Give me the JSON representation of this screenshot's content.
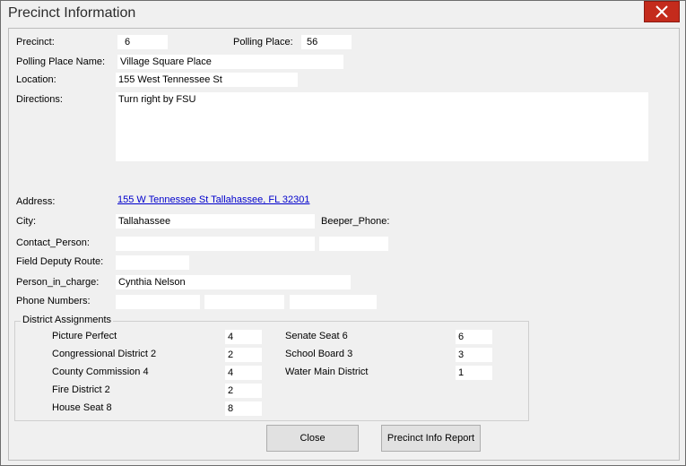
{
  "window": {
    "title": "Precinct Information"
  },
  "fields": {
    "precinct_label": "Precinct:",
    "precinct_value": "6",
    "polling_place_label": "Polling Place:",
    "polling_place_value": "56",
    "polling_place_name_label": "Polling Place Name:",
    "polling_place_name_value": "Village Square Place",
    "location_label": "Location:",
    "location_value": "155 West Tennessee St",
    "directions_label": "Directions:",
    "directions_value": "Turn right by FSU",
    "address_label": "Address:",
    "address_link": "155 W Tennessee St Tallahassee, FL 32301",
    "city_label": "City:",
    "city_value": "Tallahassee",
    "beeper_phone_label": "Beeper_Phone:",
    "contact_person_label": "Contact_Person:",
    "contact_person_value": "",
    "contact_person_extra_value": "",
    "field_deputy_route_label": "Field Deputy Route:",
    "field_deputy_route_value": "",
    "person_in_charge_label": "Person_in_charge:",
    "person_in_charge_value": "Cynthia Nelson",
    "phone_numbers_label": "Phone Numbers:",
    "phone_1": "",
    "phone_2": "",
    "phone_3": ""
  },
  "district_assignments": {
    "title": "District Assignments",
    "left": [
      {
        "label": "Picture Perfect",
        "value": "4"
      },
      {
        "label": "Congressional District 2",
        "value": "2"
      },
      {
        "label": "County Commission 4",
        "value": "4"
      },
      {
        "label": "Fire District 2",
        "value": "2"
      },
      {
        "label": "House Seat 8",
        "value": "8"
      }
    ],
    "right": [
      {
        "label": "Senate Seat 6",
        "value": "6"
      },
      {
        "label": "School Board 3",
        "value": "3"
      },
      {
        "label": "Water Main District",
        "value": "1"
      }
    ]
  },
  "buttons": {
    "close": "Close",
    "report": "Precinct Info Report"
  },
  "colors": {
    "close_button": "#c42b1c",
    "link": "#0000cc"
  },
  "icons": {
    "window_close": "close-icon"
  }
}
